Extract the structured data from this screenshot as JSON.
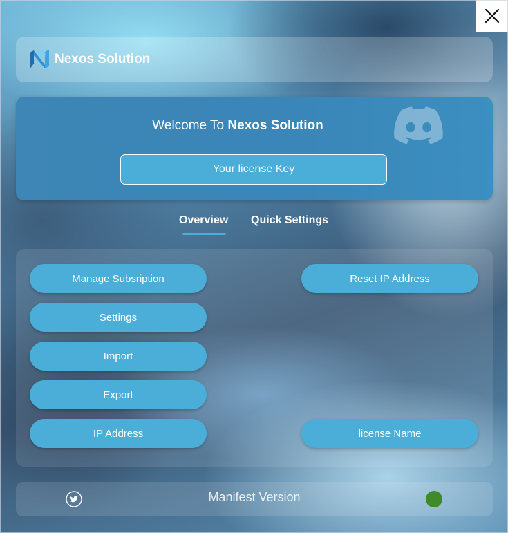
{
  "window": {
    "close_icon": "close-icon"
  },
  "header": {
    "brand": "Nexos Solution",
    "logo_icon": "nexos-logo-icon"
  },
  "welcome": {
    "prefix": "Welcome To ",
    "brand": "Nexos Solution",
    "license_placeholder": "Your license Key",
    "discord_icon": "discord-icon"
  },
  "tabs": [
    {
      "label": "Overview",
      "active": true
    },
    {
      "label": "Quick Settings",
      "active": false
    }
  ],
  "actions": {
    "manage_subscription": "Manage Subsription",
    "settings": "Settings",
    "import": "Import",
    "export": "Export",
    "ip_address": "IP Address",
    "reset_ip": "Reset IP Address",
    "license_name": "license Name"
  },
  "footer": {
    "manifest": "Manifest Version",
    "twitter_icon": "twitter-icon",
    "status_color": "#3f8a2a"
  },
  "colors": {
    "accent": "#4aaed9",
    "card": "#3d86b6"
  }
}
